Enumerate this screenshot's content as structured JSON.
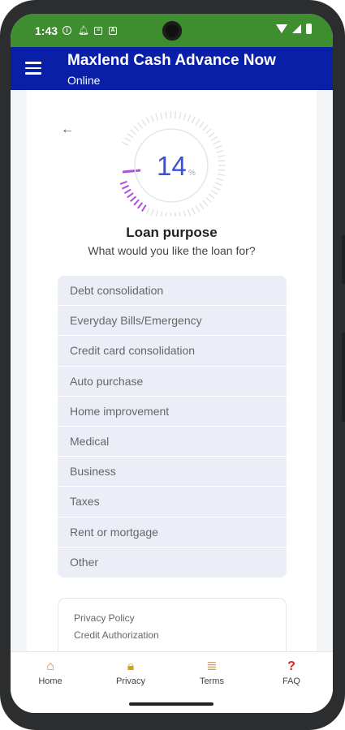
{
  "status_bar": {
    "time": "1:43",
    "icons_left": [
      "info-icon",
      "bell-icon",
      "news-icon",
      "a-icon"
    ],
    "icons_right": [
      "wifi-icon",
      "signal-icon",
      "battery-icon"
    ]
  },
  "app_bar": {
    "title": "Maxlend Cash Advance Now",
    "subtitle": "Online"
  },
  "progress": {
    "value": "14",
    "unit": "%",
    "fraction": 0.14
  },
  "question": {
    "title": "Loan purpose",
    "subtitle": "What would you like the loan for?"
  },
  "options": [
    "Debt consolidation",
    "Everyday Bills/Emergency",
    "Credit card consolidation",
    "Auto purchase",
    "Home improvement",
    "Medical",
    "Business",
    "Taxes",
    "Rent or mortgage",
    "Other"
  ],
  "footer_links": [
    "Privacy Policy",
    "Credit Authorization"
  ],
  "bottom_nav": [
    {
      "label": "Home",
      "icon": "home-icon"
    },
    {
      "label": "Privacy",
      "icon": "lock-icon"
    },
    {
      "label": "Terms",
      "icon": "scroll-icon"
    },
    {
      "label": "FAQ",
      "icon": "question-icon"
    }
  ],
  "colors": {
    "status_bar": "#3e8e2f",
    "app_bar": "#0a1fa8",
    "accent": "#3c4fd9",
    "gauge_progress": "#b04fd6"
  }
}
